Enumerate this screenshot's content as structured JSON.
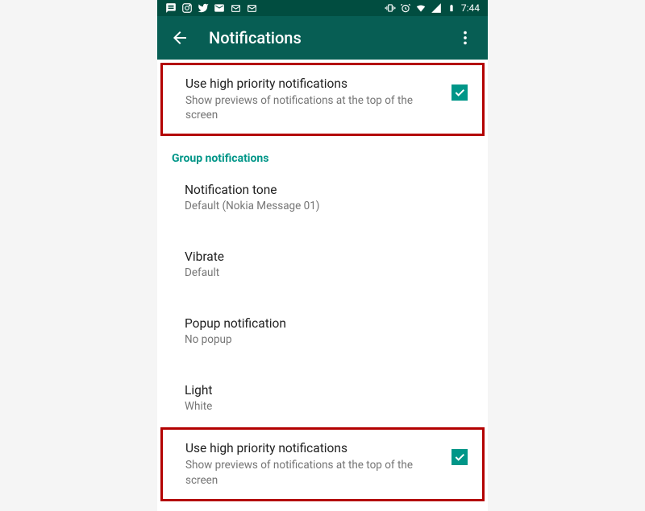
{
  "status": {
    "time": "7:44"
  },
  "appbar": {
    "title": "Notifications"
  },
  "highlight1": {
    "title": "Use high priority notifications",
    "subtitle": "Show previews of notifications at the top of the screen"
  },
  "section": {
    "header": "Group notifications"
  },
  "tone": {
    "title": "Notification tone",
    "subtitle": "Default (Nokia Message 01)"
  },
  "vibrate": {
    "title": "Vibrate",
    "subtitle": "Default"
  },
  "popup": {
    "title": "Popup notification",
    "subtitle": "No popup"
  },
  "light": {
    "title": "Light",
    "subtitle": "White"
  },
  "highlight2": {
    "title": "Use high priority notifications",
    "subtitle": "Show previews of notifications at the top of the screen"
  }
}
